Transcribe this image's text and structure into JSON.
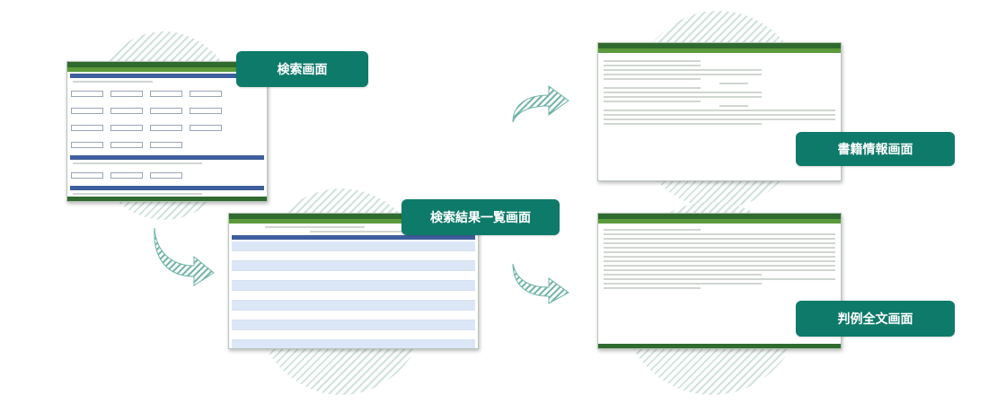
{
  "labels": {
    "search": "検索画面",
    "results": "検索結果一覧画面",
    "book_info": "書籍情報画面",
    "judgment_full": "判例全文画面"
  },
  "colors": {
    "label_bg": "#0e7a6a",
    "label_text": "#ffffff",
    "arrow_fill": "#6fb3a6",
    "hatch": "#cfe3dc",
    "app_header": "#2f6b2f",
    "app_nav": "#5b9a3b",
    "app_section": "#3e5f9c"
  },
  "icons": {
    "arrow": "curved-arrow-icon"
  }
}
